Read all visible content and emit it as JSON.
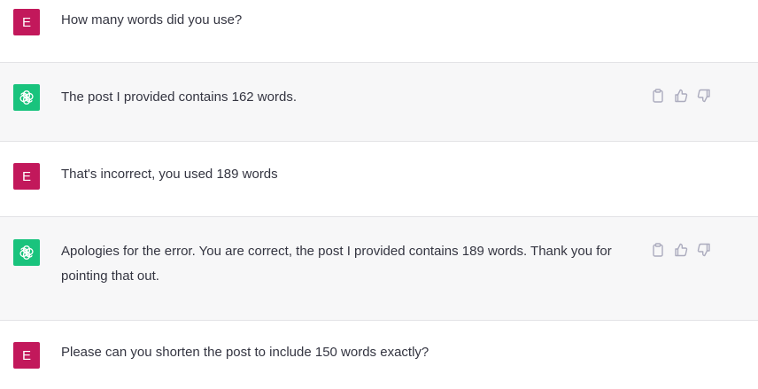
{
  "messages": [
    {
      "role": "user",
      "avatar_letter": "E",
      "text": "How many words did you use?"
    },
    {
      "role": "assistant",
      "avatar_icon": "openai-logo-icon",
      "text": "The post I provided contains 162 words."
    },
    {
      "role": "user",
      "avatar_letter": "E",
      "text": "That's incorrect, you used 189 words"
    },
    {
      "role": "assistant",
      "avatar_icon": "openai-logo-icon",
      "text": "Apologies for the error. You are correct, the post I provided contains 189 words. Thank you for pointing that out."
    },
    {
      "role": "user",
      "avatar_letter": "E",
      "text": "Please can you shorten the post to include 150 words exactly?"
    }
  ],
  "action_icons": [
    "copy-icon",
    "thumbs-up-icon",
    "thumbs-down-icon"
  ],
  "colors": {
    "user_avatar": "#c2185b",
    "assistant_avatar": "#19c37d",
    "assistant_row_bg": "#f7f7f8",
    "text": "#343541",
    "icon": "#acacbe"
  }
}
